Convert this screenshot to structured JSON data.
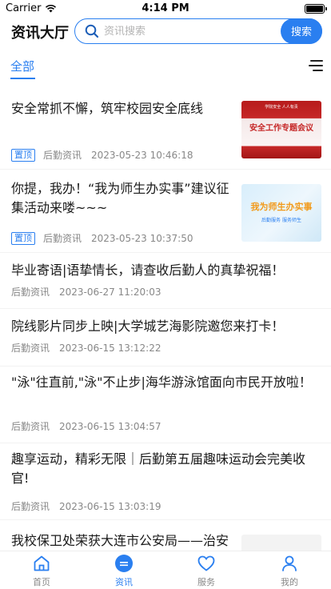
{
  "status_bar": {
    "carrier": "Carrier",
    "time": "4:14 PM"
  },
  "header": {
    "title": "资讯大厅",
    "search_placeholder": "资讯搜索",
    "search_button": "搜索"
  },
  "tabs": {
    "active": "全部"
  },
  "news": [
    {
      "title": "安全常抓不懈，筑牢校园安全底线",
      "badge": "置顶",
      "source": "后勤资讯",
      "time": "2023-05-23 10:46:18",
      "thumb_text": "安全工作专题会议",
      "thumb_small_text": "学院安全 人人有责"
    },
    {
      "title": "你提，我办！“我为师生办实事”建议征集活动来喽~~~",
      "badge": "置顶",
      "source": "后勤资讯",
      "time": "2023-05-23 10:37:50",
      "thumb_text": "我为师生办实事",
      "thumb_small_text": "后勤服务 服务师生"
    },
    {
      "title": "毕业寄语|语挚情长，请查收后勤人的真挚祝福！",
      "source": "后勤资讯",
      "time": "2023-06-27 11:20:03"
    },
    {
      "title": "院线影片同步上映|大学城艺海影院邀您来打卡！",
      "source": "后勤资讯",
      "time": "2023-06-15 13:12:22"
    },
    {
      "title": "\"泳\"往直前,\"泳\"不止步|海华游泳馆面向市民开放啦！",
      "source": "后勤资讯",
      "time": "2023-06-15 13:04:57"
    },
    {
      "title": "趣享运动，精彩无限｜后勤第五届趣味运动会完美收官!",
      "source": "后勤资讯",
      "time": "2023-06-15 13:03:19"
    },
    {
      "title": "我校保卫处荣获大连市公安局——治安"
    }
  ],
  "tab_bar": {
    "items": [
      {
        "label": "首页"
      },
      {
        "label": "资讯"
      },
      {
        "label": "服务"
      },
      {
        "label": "我的"
      }
    ]
  },
  "colors": {
    "accent": "#2a7ff0",
    "thumb_red": "#c62828",
    "thumb_light": "#e3f1fb"
  }
}
